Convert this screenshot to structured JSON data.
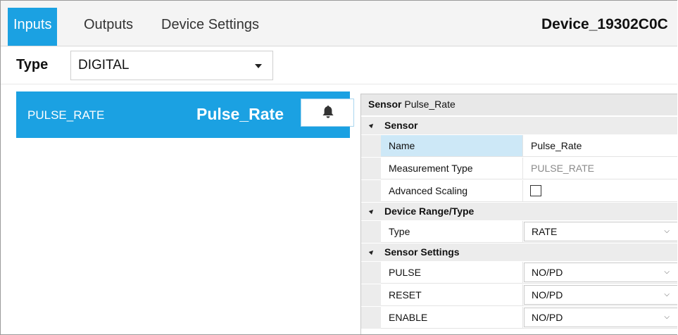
{
  "tabs": [
    {
      "label": "Inputs",
      "active": true
    },
    {
      "label": "Outputs",
      "active": false
    },
    {
      "label": "Device Settings",
      "active": false
    }
  ],
  "device_title": "Device_19302C0C",
  "type_row": {
    "label": "Type",
    "selected": "DIGITAL"
  },
  "sensor_list": [
    {
      "code": "PULSE_RATE",
      "name": "Pulse_Rate",
      "icon": "bell-icon"
    }
  ],
  "property_grid": {
    "header_prefix": "Sensor",
    "header_name": "Pulse_Rate",
    "categories": [
      {
        "label": "Sensor",
        "rows": [
          {
            "key": "Name",
            "value": "Pulse_Rate",
            "kind": "text",
            "selected": true
          },
          {
            "key": "Measurement Type",
            "value": "PULSE_RATE",
            "kind": "readonly"
          },
          {
            "key": "Advanced Scaling",
            "value": "",
            "kind": "checkbox",
            "checked": false
          }
        ]
      },
      {
        "label": "Device Range/Type",
        "rows": [
          {
            "key": "Type",
            "value": "RATE",
            "kind": "dropdown"
          }
        ]
      },
      {
        "label": "Sensor Settings",
        "rows": [
          {
            "key": "PULSE",
            "value": "NO/PD",
            "kind": "dropdown"
          },
          {
            "key": "RESET",
            "value": "NO/PD",
            "kind": "dropdown"
          },
          {
            "key": "ENABLE",
            "value": "NO/PD",
            "kind": "dropdown"
          }
        ]
      }
    ]
  },
  "colors": {
    "accent": "#1ba1e2",
    "selected_row": "#cde8f7",
    "category_bg": "#ececec"
  }
}
